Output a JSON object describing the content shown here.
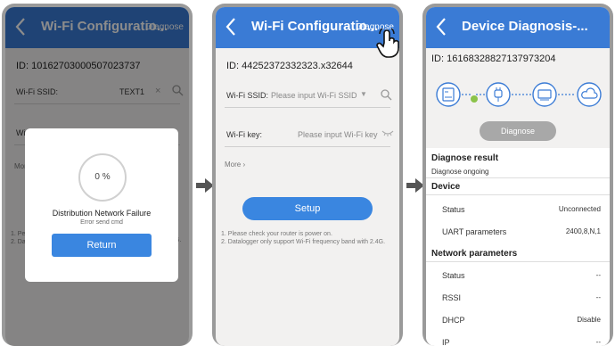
{
  "panel1": {
    "header_title": "Wi-Fi Configuratio...",
    "header_link": "Diagnose",
    "id_text": "ID: 10162703000507023737",
    "ssid_label": "Wi-Fi SSID:",
    "ssid_value": "TEXT1",
    "key_label": "Wi",
    "more_label": "More",
    "note_1": "1. Pe",
    "note_2": "2. Da",
    "note_suffix": "G.",
    "dialog": {
      "progress": "0 %",
      "title": "Distribution Network Failure",
      "subtitle": "Error send cmd",
      "button": "Return"
    }
  },
  "panel2": {
    "header_title": "Wi-Fi Configuratio...",
    "header_link": "Diagnose",
    "id_text": "ID: 44252372332323.x32644",
    "ssid_label": "Wi-Fi SSID:",
    "ssid_placeholder": "Please input Wi-Fi SSID",
    "key_label": "Wi-Fi key:",
    "key_placeholder": "Please input Wi-Fi key",
    "more_label": "More",
    "button": "Setup",
    "note_1": "1. Please check your router is power on.",
    "note_2": "2. Datalogger only support Wi-Fi frequency band with 2.4G."
  },
  "panel3": {
    "header_title": "Device Diagnosis-...",
    "id_text": "ID: 16168328827137973204",
    "diagnose_button": "Diagnose",
    "result_title": "Diagnose result",
    "result_status": "Diagnose ongoing",
    "device_section": "Device",
    "device_rows": [
      {
        "key": "Status",
        "value": "Unconnected"
      },
      {
        "key": "UART parameters",
        "value": "2400,8,N,1"
      }
    ],
    "network_section": "Network parameters",
    "network_rows": [
      {
        "key": "Status",
        "value": "--"
      },
      {
        "key": "RSSI",
        "value": "--"
      },
      {
        "key": "DHCP",
        "value": "Disable"
      },
      {
        "key": "IP",
        "value": "--"
      }
    ]
  },
  "colors": {
    "header_blue": "#3a7bd5",
    "button_blue": "#3a86e0",
    "status_green": "#8bc34a"
  },
  "icons": [
    "back-chevron-icon",
    "close-icon",
    "search-icon",
    "dropdown-icon",
    "eye-icon",
    "hand-pointer-icon",
    "datalogger-icon",
    "plug-icon",
    "router-icon",
    "cloud-icon",
    "arrow-right-icon"
  ]
}
